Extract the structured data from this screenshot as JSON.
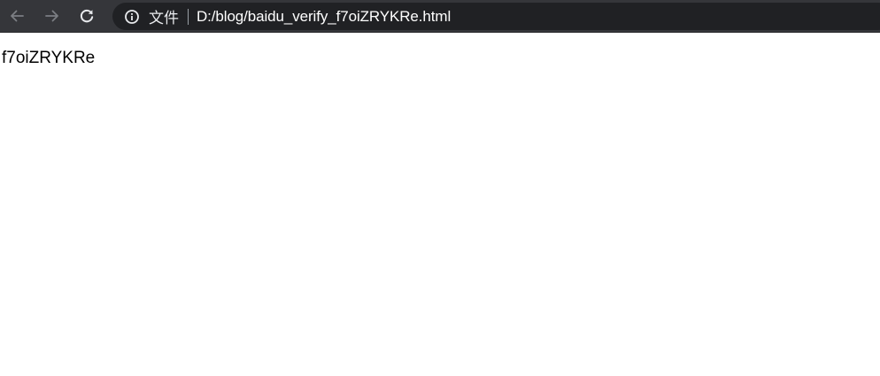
{
  "browser": {
    "toolbar": {
      "back_icon": "arrow-left-icon",
      "forward_icon": "arrow-right-icon",
      "reload_icon": "reload-icon",
      "back_disabled": true,
      "forward_disabled": true
    },
    "omnibox": {
      "site_info_icon": "info-circle-icon",
      "site_info_label": "文件",
      "url": "D:/blog/baidu_verify_f7oiZRYKRe.html"
    },
    "colors": {
      "toolbar_bg": "#35363a",
      "omnibox_bg": "#202124",
      "icon_disabled": "#9aa0a6",
      "icon_enabled": "#e8eaed"
    }
  },
  "page": {
    "body_text": "f7oiZRYKRe"
  }
}
